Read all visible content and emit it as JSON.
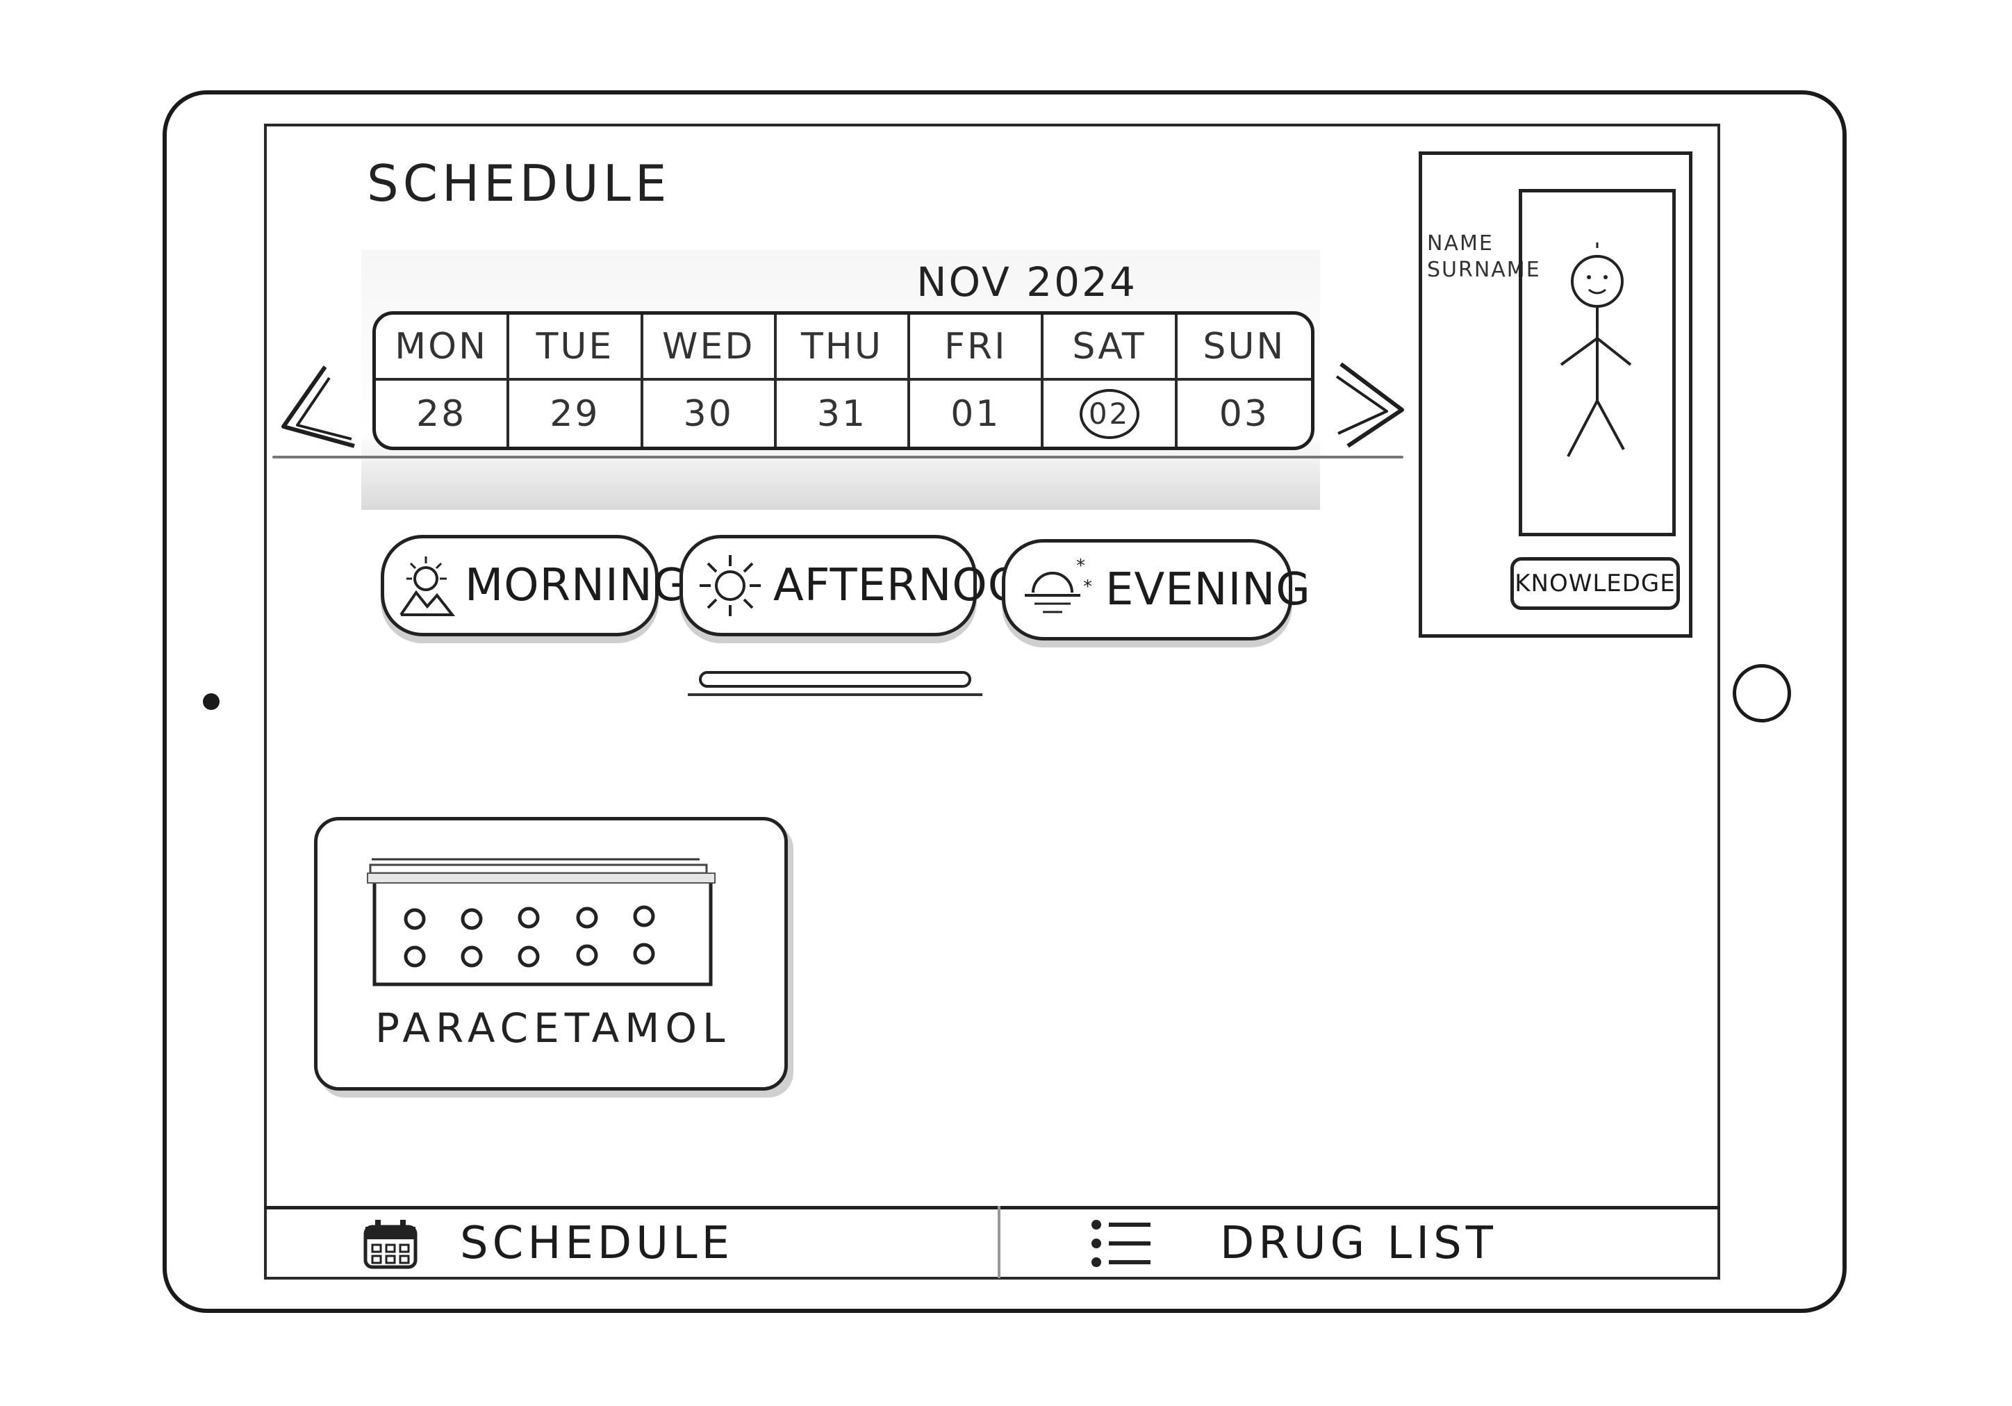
{
  "header": {
    "title": "SCHEDULE"
  },
  "calendar": {
    "month": "NOV 2024",
    "days": [
      {
        "name": "MON",
        "date": "28",
        "selected": false
      },
      {
        "name": "TUE",
        "date": "29",
        "selected": false
      },
      {
        "name": "WED",
        "date": "30",
        "selected": false
      },
      {
        "name": "THU",
        "date": "31",
        "selected": false
      },
      {
        "name": "FRI",
        "date": "01",
        "selected": false
      },
      {
        "name": "SAT",
        "date": "02",
        "selected": true
      },
      {
        "name": "SUN",
        "date": "03",
        "selected": false
      }
    ]
  },
  "time_filters": [
    {
      "label": "MORNING",
      "icon": "sunrise-mountain-icon"
    },
    {
      "label": "AFTERNOON",
      "icon": "sun-icon",
      "selected": true
    },
    {
      "label": "EVENING",
      "icon": "sunset-icon"
    }
  ],
  "profile": {
    "name": "NAME",
    "surname": "SURNAME",
    "avatar_icon": "stick-figure-icon",
    "knowledge_button": "KNOWLEDGE"
  },
  "drugs": [
    {
      "name": "PARACETAMOL",
      "icon": "blister-pack-icon"
    }
  ],
  "bottom_nav": {
    "schedule": {
      "label": "SCHEDULE",
      "icon": "calendar-icon"
    },
    "drug_list": {
      "label": "DRUG LIST",
      "icon": "list-icon"
    }
  },
  "colors": {
    "ink": "#1b1b1b",
    "paper": "#ffffff",
    "shadow": "#d0d0d0"
  }
}
